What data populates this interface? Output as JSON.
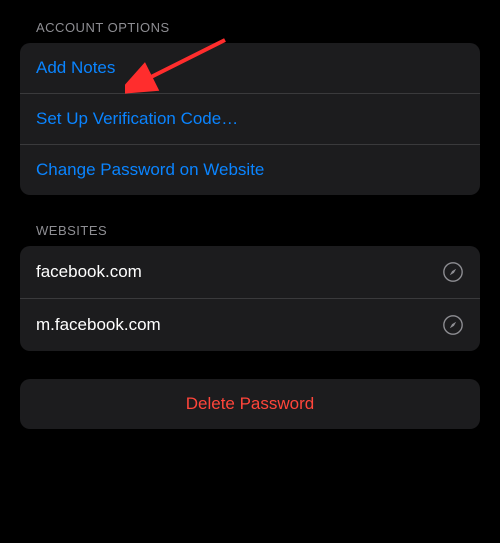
{
  "sections": {
    "account_options": {
      "header": "ACCOUNT OPTIONS",
      "items": {
        "add_notes": "Add Notes",
        "setup_verification": "Set Up Verification Code…",
        "change_password": "Change Password on Website"
      }
    },
    "websites": {
      "header": "WEBSITES",
      "items": {
        "site0": "facebook.com",
        "site1": "m.facebook.com"
      }
    },
    "delete": {
      "label": "Delete Password"
    }
  }
}
